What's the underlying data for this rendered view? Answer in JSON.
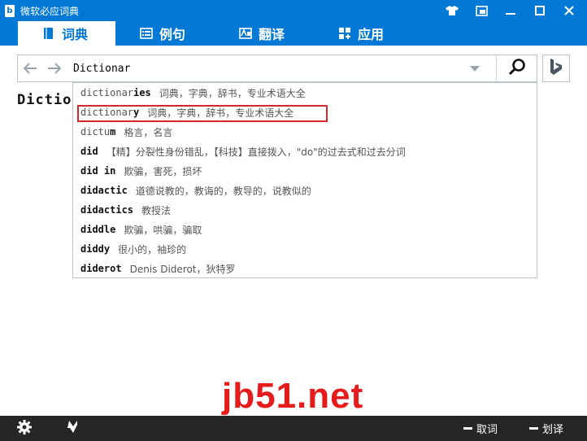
{
  "window": {
    "title": "微软必应词典",
    "controls": [
      "shirt-icon",
      "window-mode-icon",
      "minimize-icon",
      "maximize-icon",
      "close-icon"
    ]
  },
  "tabs": [
    {
      "label": "词典",
      "icon": "book-icon",
      "active": true
    },
    {
      "label": "例句",
      "icon": "list-icon",
      "active": false
    },
    {
      "label": "翻译",
      "icon": "translate-icon",
      "active": false
    },
    {
      "label": "应用",
      "icon": "apps-icon",
      "active": false
    }
  ],
  "search": {
    "value": "Dictionar",
    "back_icon": "back-arrow-icon",
    "forward_icon": "forward-arrow-icon",
    "search_icon": "search-icon",
    "bing_icon": "bing-logo-icon"
  },
  "partial_word": "Dictio",
  "suggestions": [
    {
      "prefix": "dictionar",
      "rest": "ies",
      "def": "词典，字典，辞书，专业术语大全"
    },
    {
      "prefix": "dictionar",
      "rest": "y",
      "def": "词典，字典，辞书，专业术语大全",
      "highlighted": true
    },
    {
      "prefix": "dictu",
      "rest": "m",
      "def": "格言，名言"
    },
    {
      "prefix": "",
      "rest": "did",
      "def": "【精】分裂性身份错乱，【科技】直接拨入，\"do\"的过去式和过去分词"
    },
    {
      "prefix": "",
      "rest": "did in",
      "def": "欺骗，害死，损坏"
    },
    {
      "prefix": "",
      "rest": "didactic",
      "def": "道德说教的，教诲的，教导的，说教似的"
    },
    {
      "prefix": "",
      "rest": "didactics",
      "def": "教授法"
    },
    {
      "prefix": "",
      "rest": "diddle",
      "def": "欺骗，哄骗，骗取"
    },
    {
      "prefix": "",
      "rest": "diddy",
      "def": "很小的，袖珍的"
    },
    {
      "prefix": "",
      "rest": "diderot",
      "def": "Denis Diderot，狄特罗"
    }
  ],
  "watermark": "jb51.net",
  "bottom": {
    "settings_icon": "gear-icon",
    "feedback_icon": "feedback-icon",
    "cancel_word": "取词",
    "cancel_select": "划译"
  },
  "colors": {
    "accent": "#0378d4",
    "highlight_border": "#d9262c",
    "watermark": "#e61c1c",
    "bottom_bar": "#262626"
  }
}
